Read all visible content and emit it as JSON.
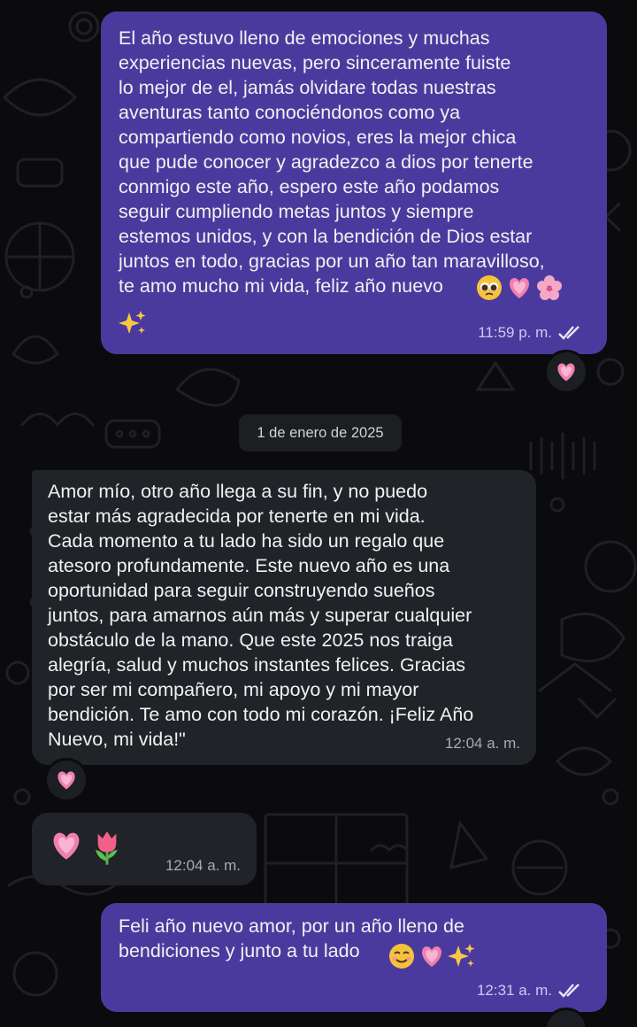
{
  "messages": [
    {
      "direction": "outgoing",
      "text": "El año estuvo lleno de emociones y muchas\nexperiencias nuevas, pero sinceramente fuiste\nlo mejor de el, jamás olvidare todas nuestras\naventuras tanto conociéndonos como ya\ncompartiendo como novios, eres la mejor chica\nque pude conocer y agradezco a dios por tenerte\nconmigo este año, espero este año podamos\nseguir cumpliendo metas juntos y siempre\nestemos unidos, y con la bendición de Dios estar\njuntos en todo, gracias por un año tan maravilloso,\nte amo mucho mi vida, feliz año nuevo",
      "emojis": [
        "pleading-face",
        "growing-heart",
        "cherry-blossom",
        "sparkles"
      ],
      "time": "11:59 p. m.",
      "status": "read-double-check",
      "reaction": "growing-heart"
    },
    {
      "direction": "incoming",
      "text": "Amor mío, otro año llega a su fin, y no puedo\nestar más agradecida por tenerte en mi vida.\nCada momento a tu lado ha sido un regalo que\natesoro profundamente. Este nuevo año es una\noportunidad para seguir construyendo sueños\njuntos, para amarnos aún más y superar cualquier\nobstáculo de la mano. Que este 2025 nos traiga\nalegría, salud y muchos instantes felices. Gracias\npor ser mi compañero, mi apoyo y mi mayor\nbendición. Te amo con todo mi corazón. ¡Feliz Año\nNuevo, mi vida!\"",
      "time": "12:04 a. m.",
      "reaction": "growing-heart"
    },
    {
      "direction": "incoming",
      "emojis": [
        "growing-heart",
        "tulip"
      ],
      "time": "12:04 a. m."
    },
    {
      "direction": "outgoing",
      "text": "Feli año nuevo amor, por un año lleno de\nbendiciones y junto a tu lado",
      "emojis": [
        "smiling-face",
        "growing-heart",
        "sparkles"
      ],
      "time": "12:31 a. m.",
      "status": "read-double-check"
    }
  ],
  "date_separator": "1 de enero de 2025",
  "colors": {
    "outgoing_bubble": "#4b3a9e",
    "incoming_bubble": "#202327",
    "background": "#0b0b0d",
    "wallpaper_doodle": "#1d1d22"
  }
}
